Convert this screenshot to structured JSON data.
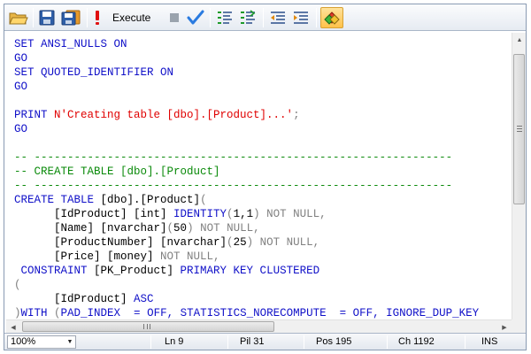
{
  "toolbar": {
    "open_icon": "folder-open-icon",
    "save_icon": "save-icon",
    "save_all_icon": "save-all-icon",
    "execute_icon": "exclamation-icon",
    "execute_label": "Execute",
    "stop_icon": "stop-icon",
    "parse_icon": "checkmark-icon",
    "comment_icon": "comment-lines-icon",
    "uncomment_icon": "uncomment-lines-icon",
    "decrease_indent_icon": "decrease-indent-icon",
    "increase_indent_icon": "increase-indent-icon",
    "results_icon": "results-pane-icon"
  },
  "editor": {
    "lines": [
      {
        "segments": [
          {
            "t": "SET ANSI_NULLS ON",
            "c": "kw"
          }
        ]
      },
      {
        "segments": [
          {
            "t": "GO",
            "c": "kw"
          }
        ]
      },
      {
        "segments": [
          {
            "t": "SET QUOTED_IDENTIFIER ON",
            "c": "kw"
          }
        ]
      },
      {
        "segments": [
          {
            "t": "GO",
            "c": "kw"
          }
        ]
      },
      {
        "segments": []
      },
      {
        "segments": [
          {
            "t": "PRINT ",
            "c": "kw"
          },
          {
            "t": "N'Creating table [dbo].[Product]...'",
            "c": "rd"
          },
          {
            "t": ";",
            "c": "gy"
          }
        ]
      },
      {
        "segments": [
          {
            "t": "GO",
            "c": "kw"
          }
        ]
      },
      {
        "segments": []
      },
      {
        "segments": [
          {
            "t": "-- ---------------------------------------------------------------",
            "c": "gr"
          }
        ]
      },
      {
        "segments": [
          {
            "t": "-- CREATE TABLE [dbo].[Product]",
            "c": "gr"
          }
        ]
      },
      {
        "segments": [
          {
            "t": "-- ---------------------------------------------------------------",
            "c": "gr"
          }
        ]
      },
      {
        "segments": [
          {
            "t": "CREATE TABLE ",
            "c": "kw"
          },
          {
            "t": "[dbo].[Product]",
            "c": "tx"
          },
          {
            "t": "(",
            "c": "gy"
          }
        ]
      },
      {
        "segments": [
          {
            "t": "      [IdProduct] [int] ",
            "c": "tx"
          },
          {
            "t": "IDENTITY",
            "c": "kw"
          },
          {
            "t": "(",
            "c": "gy"
          },
          {
            "t": "1,1",
            "c": "tx"
          },
          {
            "t": ") NOT NULL,",
            "c": "gy"
          }
        ]
      },
      {
        "segments": [
          {
            "t": "      [Name] [nvarchar]",
            "c": "tx"
          },
          {
            "t": "(",
            "c": "gy"
          },
          {
            "t": "50",
            "c": "tx"
          },
          {
            "t": ") NOT NULL,",
            "c": "gy"
          }
        ]
      },
      {
        "segments": [
          {
            "t": "      [ProductNumber] [nvarchar]",
            "c": "tx"
          },
          {
            "t": "(",
            "c": "gy"
          },
          {
            "t": "25",
            "c": "tx"
          },
          {
            "t": ") NOT NULL,",
            "c": "gy"
          }
        ]
      },
      {
        "segments": [
          {
            "t": "      [Price] [money] ",
            "c": "tx"
          },
          {
            "t": "NOT NULL,",
            "c": "gy"
          }
        ]
      },
      {
        "segments": [
          {
            "t": " CONSTRAINT ",
            "c": "kw"
          },
          {
            "t": "[PK_Product] ",
            "c": "tx"
          },
          {
            "t": "PRIMARY KEY CLUSTERED",
            "c": "kw"
          }
        ]
      },
      {
        "segments": [
          {
            "t": "(",
            "c": "gy"
          }
        ]
      },
      {
        "segments": [
          {
            "t": "      [IdProduct] ",
            "c": "tx"
          },
          {
            "t": "ASC",
            "c": "kw"
          }
        ]
      },
      {
        "segments": [
          {
            "t": ")",
            "c": "gy"
          },
          {
            "t": "WITH ",
            "c": "kw"
          },
          {
            "t": "(",
            "c": "gy"
          },
          {
            "t": "PAD_INDEX  = OFF, STATISTICS_NORECOMPUTE  = OFF, IGNORE_DUP_KEY",
            "c": "kw"
          }
        ]
      }
    ]
  },
  "status": {
    "zoom": "100%",
    "line": "Ln 9",
    "pil": "Pil 31",
    "pos": "Pos 195",
    "ch": "Ch 1192",
    "mode": "INS"
  }
}
